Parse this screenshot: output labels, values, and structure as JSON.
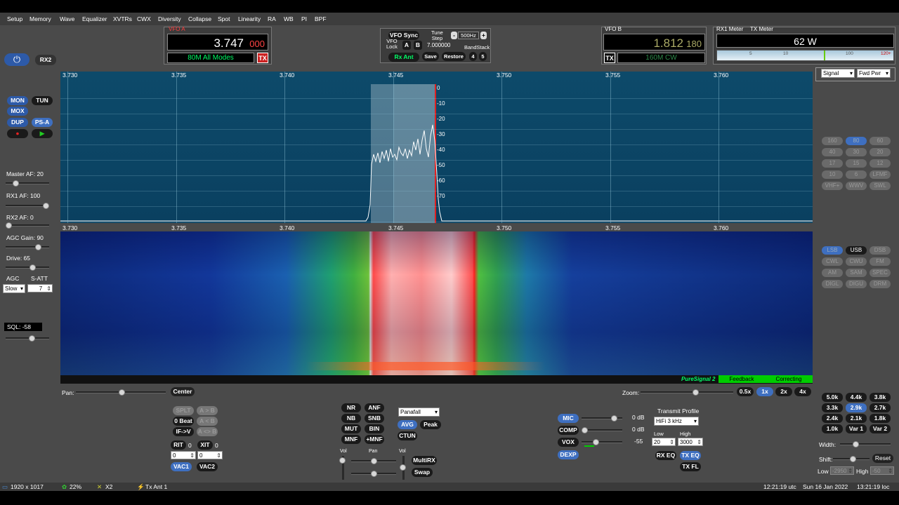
{
  "menu": [
    "Setup",
    "Memory",
    "Wave",
    "Equalizer",
    "XVTRs",
    "CWX",
    "Diversity",
    "Collapse",
    "Spot",
    "Linearity",
    "RA",
    "WB",
    "PI",
    "BPF"
  ],
  "left": {
    "rx2": "RX2",
    "mon": "MON",
    "tun": "TUN",
    "mox": "MOX",
    "dup": "DUP",
    "ps": "PS-A",
    "master_af": "Master AF:  20",
    "rx1_af": "RX1 AF:  100",
    "rx2_af": "RX2 AF:  0",
    "agc_gain": "AGC Gain:  90",
    "drive": "Drive:  65",
    "agc": "AGC",
    "satt": "S-ATT",
    "agc_mode": "Slow",
    "satt_val": "7",
    "sql": "SQL:  -58",
    "levels": {
      "master_af": 0.18,
      "rx1_af": 1.0,
      "rx2_af": 0.0,
      "agc_gain": 0.8,
      "drive": 0.65,
      "sql": 0.62
    }
  },
  "vfoa": {
    "label": "VFO A",
    "freq": "3.747",
    "freq_small": "000",
    "mode": "80M All Modes",
    "tx": "TX"
  },
  "center": {
    "vfo_sync": "VFO Sync",
    "vfo_lock": "VFO\nLock",
    "a": "A",
    "b": "B",
    "tune_step": "Tune\nStep",
    "step": "500Hz",
    "minus": "-",
    "plus": "+",
    "freq": "7.000000",
    "bandstack": "BandStack",
    "rx_ant": "Rx Ant",
    "save": "Save",
    "restore": "Restore",
    "n4": "4",
    "n5": "5"
  },
  "vfob": {
    "label": "VFO B",
    "freq": "1.812",
    "freq_small": "180",
    "mode": "160M CW",
    "tx": "TX"
  },
  "meter": {
    "rx1": "RX1 Meter",
    "tx": "TX Meter",
    "value": "62 W",
    "scale": [
      "5",
      "10",
      "100",
      "120+"
    ],
    "sel1": "Signal",
    "sel2": "Fwd Pwr"
  },
  "pan": {
    "freqs": [
      "3.730",
      "3.735",
      "3.740",
      "3.745",
      "3.750",
      "3.755",
      "3.760"
    ],
    "db": [
      "0",
      "-10",
      "-20",
      "-30",
      "-40",
      "-50",
      "-60",
      "-70"
    ]
  },
  "bands": [
    "160",
    "80",
    "60",
    "40",
    "30",
    "20",
    "17",
    "15",
    "12",
    "10",
    "6",
    "LFMF",
    "VHF+",
    "WWV",
    "SWL"
  ],
  "modes": [
    "LSB",
    "USB",
    "DSB",
    "CWL",
    "CWU",
    "FM",
    "AM",
    "SAM",
    "SPEC",
    "DIGL",
    "DIGU",
    "DRM"
  ],
  "ps_bar": {
    "ps": "PureSignal 2",
    "feedback": "Feedback",
    "correcting": "Correcting"
  },
  "bottom": {
    "pan": "Pan:",
    "center": "Center",
    "zoom": "Zoom:",
    "zoom_btns": [
      "0.5x",
      "1x",
      "2x",
      "4x"
    ],
    "splt": "SPLT",
    "ab": "A > B",
    "zero_beat": "0 Beat",
    "ba": "A < B",
    "ifv": "IF->V",
    "aswap": "A <> B",
    "rit": "RIT",
    "rit_val": "0",
    "xit": "XIT",
    "xit_val": "0",
    "rit_spin": "0",
    "xit_spin": "0",
    "vac1": "VAC1",
    "vac2": "VAC2",
    "nr": "NR",
    "anf": "ANF",
    "nb": "NB",
    "snb": "SNB",
    "mut": "MUT",
    "bin": "BIN",
    "mnf": "MNF",
    "pmnf": "+MNF",
    "display": "Panafall",
    "avg": "AVG",
    "peak": "Peak",
    "ctun": "CTUN",
    "vol": "Vol",
    "pan2": "Pan",
    "vol2": "Vol",
    "multirx": "MultiRX",
    "swap": "Swap",
    "mic": "MIC",
    "mic_db": "0 dB",
    "comp": "COMP",
    "comp_db": "0 dB",
    "vox": "VOX",
    "vox_val": "-55",
    "dexp": "DEXP",
    "tx_profile": "Transmit Profile",
    "profile": "HiFi 3 kHz",
    "low": "Low",
    "high": "High",
    "low_val": "20",
    "high_val": "3000",
    "rx_eq": "RX EQ",
    "tx_eq": "TX EQ",
    "tx_fl": "TX FL"
  },
  "filters": [
    "5.0k",
    "4.4k",
    "3.8k",
    "3.3k",
    "2.9k",
    "2.7k",
    "2.4k",
    "2.1k",
    "1.8k",
    "1.0k",
    "Var 1",
    "Var 2"
  ],
  "filter_ctl": {
    "width": "Width:",
    "shift": "Shift:",
    "reset": "Reset",
    "low": "Low",
    "low_val": "-2950",
    "high": "High",
    "high_val": "-50"
  },
  "status": {
    "resolution": "1920 x 1017",
    "cpu": "22%",
    "x2": "X2",
    "txant": "Tx Ant 1",
    "utc": "12:21:19 utc",
    "date": "Sun 16 Jan 2022",
    "loc": "13:21:19 loc"
  },
  "colors": {
    "accent": "#3e6fc0",
    "panel": "#4a4a4a",
    "vfoa_freq": "#ffffff",
    "vfoa_small": "#ff4444",
    "mode_green": "#00ff66",
    "ps_green": "#00cc00"
  }
}
